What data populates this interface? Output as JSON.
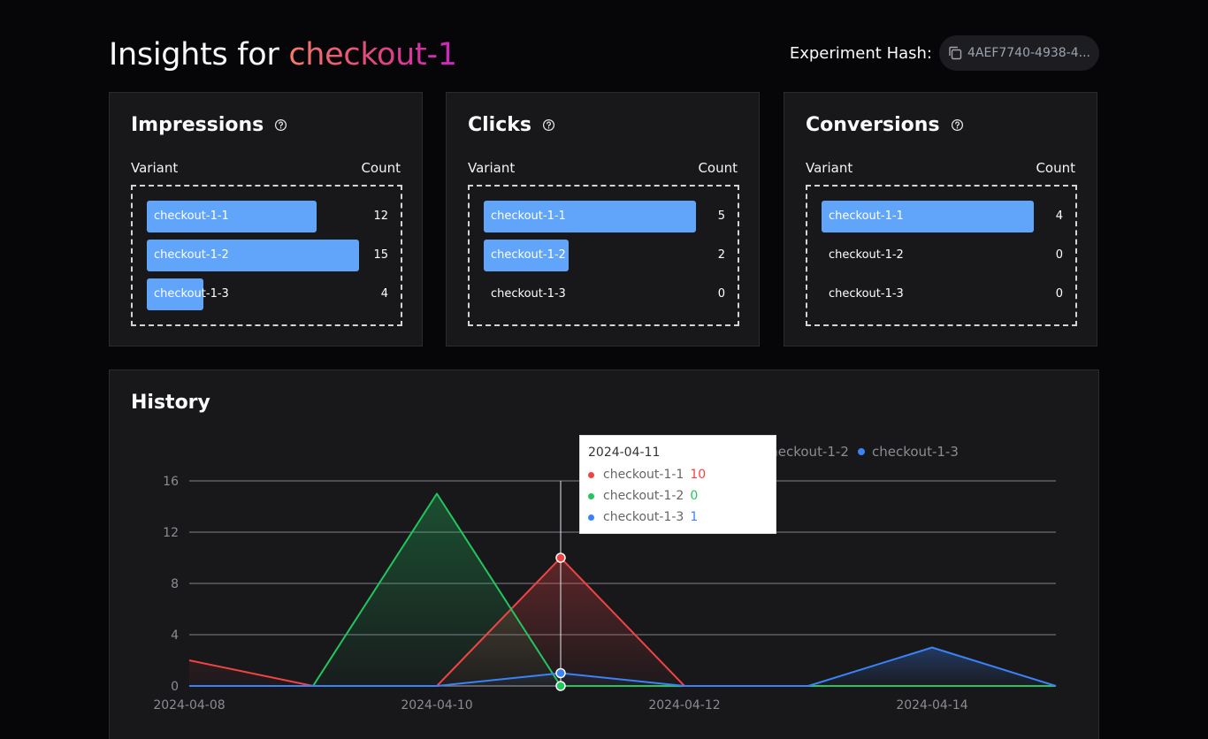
{
  "header": {
    "title_prefix": "Insights for ",
    "experiment_name": "checkout-1",
    "hash_label": "Experiment Hash:",
    "hash_value": "4AEF7740-4938-4..."
  },
  "cards": [
    {
      "title": "Impressions",
      "col_variant": "Variant",
      "col_count": "Count",
      "rows": [
        {
          "label": "checkout-1-1",
          "count": "12",
          "value": 12
        },
        {
          "label": "checkout-1-2",
          "count": "15",
          "value": 15
        },
        {
          "label": "checkout-1-3",
          "count": "4",
          "value": 4
        }
      ]
    },
    {
      "title": "Clicks",
      "col_variant": "Variant",
      "col_count": "Count",
      "rows": [
        {
          "label": "checkout-1-1",
          "count": "5",
          "value": 5
        },
        {
          "label": "checkout-1-2",
          "count": "2",
          "value": 2
        },
        {
          "label": "checkout-1-3",
          "count": "0",
          "value": 0
        }
      ]
    },
    {
      "title": "Conversions",
      "col_variant": "Variant",
      "col_count": "Count",
      "rows": [
        {
          "label": "checkout-1-1",
          "count": "4",
          "value": 4
        },
        {
          "label": "checkout-1-2",
          "count": "0",
          "value": 0
        },
        {
          "label": "checkout-1-3",
          "count": "0",
          "value": 0
        }
      ]
    }
  ],
  "history": {
    "title": "History",
    "tooltip": {
      "date": "2024-04-11",
      "rows": [
        {
          "name": "checkout-1-1",
          "value": "10"
        },
        {
          "name": "checkout-1-2",
          "value": "0"
        },
        {
          "name": "checkout-1-3",
          "value": "1"
        }
      ]
    }
  },
  "colors": {
    "bar": "#60a5fa",
    "series1": "#ef4444",
    "series2": "#22c55e",
    "series3": "#3b82f6"
  },
  "icons": {
    "copy": "copy-icon",
    "help": "help-circle-icon"
  },
  "chart_data": {
    "type": "area",
    "x": [
      "2024-04-08",
      "2024-04-09",
      "2024-04-10",
      "2024-04-11",
      "2024-04-12",
      "2024-04-13",
      "2024-04-14",
      "2024-04-15"
    ],
    "x_tick_labels": [
      "2024-04-08",
      "2024-04-10",
      "2024-04-12",
      "2024-04-14"
    ],
    "y_ticks": [
      0,
      4,
      8,
      12,
      16
    ],
    "ylim": [
      0,
      16
    ],
    "grid": true,
    "legend_position": "top-right",
    "series": [
      {
        "name": "checkout-1-1",
        "values": [
          2,
          0,
          0,
          10,
          0,
          0,
          0,
          0
        ]
      },
      {
        "name": "checkout-1-2",
        "values": [
          0,
          0,
          15,
          0,
          0,
          0,
          0,
          0
        ]
      },
      {
        "name": "checkout-1-3",
        "values": [
          0,
          0,
          0,
          1,
          0,
          0,
          3,
          0
        ]
      }
    ],
    "highlight_x": "2024-04-11"
  }
}
